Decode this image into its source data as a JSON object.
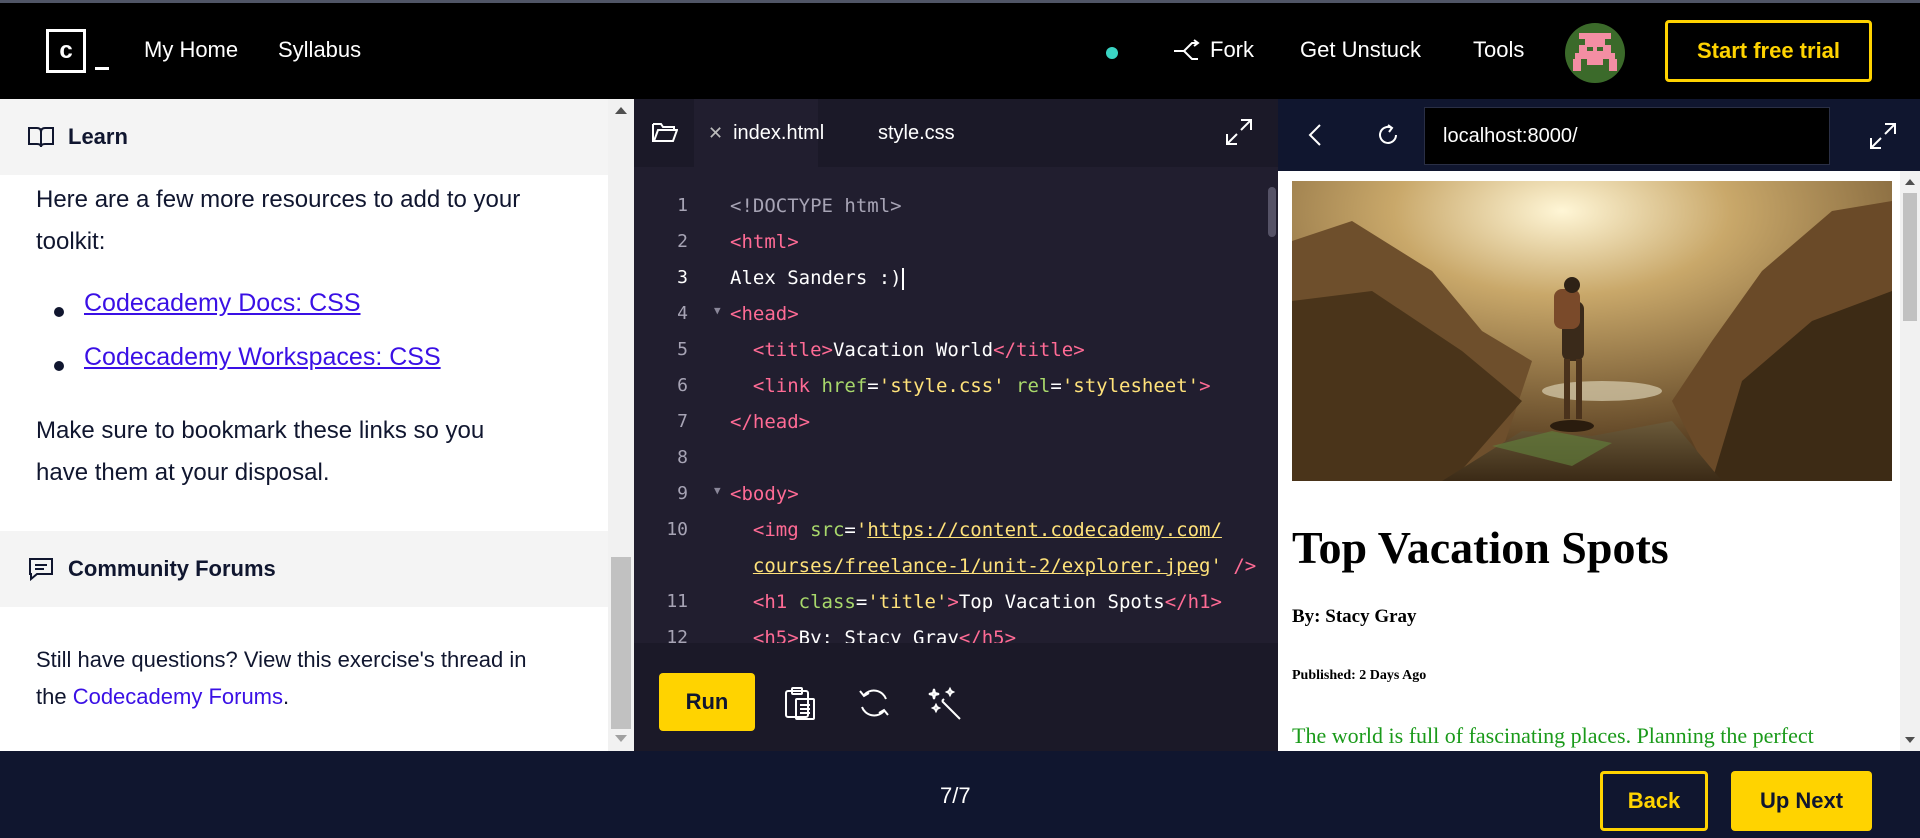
{
  "header": {
    "logo_letter": "c",
    "nav": [
      "My Home",
      "Syllabus"
    ],
    "fork": "Fork",
    "get_unstuck": "Get Unstuck",
    "tools": "Tools",
    "trial": "Start free trial"
  },
  "learn": {
    "title": "Learn",
    "intro_line1": "Here are a few more resources to add to your",
    "intro_line2": "toolkit:",
    "links": [
      "Codecademy Docs: CSS",
      "Codecademy Workspaces: CSS"
    ],
    "bookmark_line1": "Make sure to bookmark these links so you",
    "bookmark_line2": "have them at your disposal."
  },
  "forums": {
    "title": "Community Forums",
    "text_line1": "Still have questions? View this exercise's thread in",
    "text_prefix": "the ",
    "link": "Codecademy Forums",
    "text_suffix": "."
  },
  "editor": {
    "tabs": [
      "index.html",
      "style.css"
    ],
    "line_numbers": [
      "1",
      "2",
      "3",
      "4",
      "5",
      "6",
      "7",
      "8",
      "9",
      "10",
      "11",
      "12"
    ],
    "run": "Run"
  },
  "browser": {
    "url": "localhost:8000/",
    "h1": "Top Vacation Spots",
    "byline": "By: Stacy Gray",
    "published": "Published: 2 Days Ago",
    "paragraph": "The world is full of fascinating places. Planning the perfect"
  },
  "footer": {
    "pager": "7/7",
    "back": "Back",
    "next": "Up Next"
  },
  "colors": {
    "accent": "#ffd300",
    "navy": "#10162f",
    "link": "#3a10e5",
    "tag": "#ff6b95",
    "attr": "#a8d86b",
    "string": "#ffe27a",
    "paragraph_green": "#1a9a1a"
  }
}
